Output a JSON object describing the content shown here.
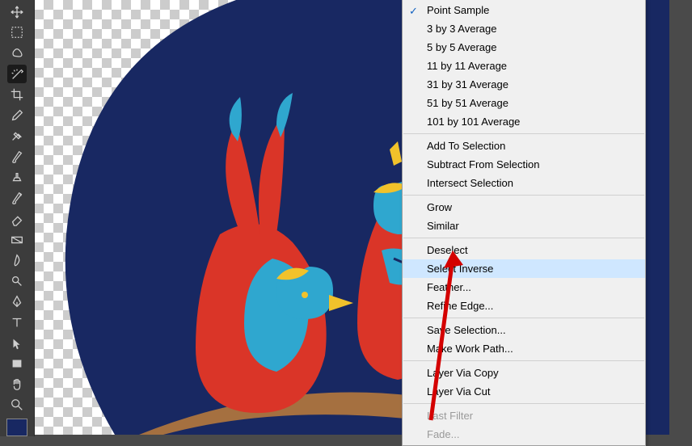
{
  "menu": {
    "items": [
      {
        "label": "Point Sample",
        "checked": true
      },
      {
        "label": "3 by 3 Average"
      },
      {
        "label": "5 by 5 Average"
      },
      {
        "label": "11 by 11 Average"
      },
      {
        "label": "31 by 31 Average"
      },
      {
        "label": "51 by 51 Average"
      },
      {
        "label": "101 by 101 Average"
      },
      {
        "sep": true
      },
      {
        "label": "Add To Selection"
      },
      {
        "label": "Subtract From Selection"
      },
      {
        "label": "Intersect Selection"
      },
      {
        "sep": true
      },
      {
        "label": "Grow"
      },
      {
        "label": "Similar"
      },
      {
        "sep": true
      },
      {
        "label": "Deselect"
      },
      {
        "label": "Select Inverse",
        "highlight": true
      },
      {
        "label": "Feather..."
      },
      {
        "label": "Refine Edge..."
      },
      {
        "sep": true
      },
      {
        "label": "Save Selection..."
      },
      {
        "label": "Make Work Path..."
      },
      {
        "sep": true
      },
      {
        "label": "Layer Via Copy"
      },
      {
        "label": "Layer Via Cut"
      },
      {
        "sep": true
      },
      {
        "label": "Last Filter",
        "disabled": true
      },
      {
        "label": "Fade...",
        "disabled": true
      }
    ]
  },
  "tools": [
    {
      "name": "move-tool"
    },
    {
      "name": "marquee-tool"
    },
    {
      "name": "lasso-tool"
    },
    {
      "name": "magic-wand-tool",
      "selected": true
    },
    {
      "name": "crop-tool"
    },
    {
      "name": "eyedropper-tool"
    },
    {
      "name": "healing-brush-tool"
    },
    {
      "name": "brush-tool"
    },
    {
      "name": "clone-stamp-tool"
    },
    {
      "name": "history-brush-tool"
    },
    {
      "name": "eraser-tool"
    },
    {
      "name": "gradient-tool"
    },
    {
      "name": "blur-tool"
    },
    {
      "name": "dodge-tool"
    },
    {
      "name": "pen-tool"
    },
    {
      "name": "type-tool"
    },
    {
      "name": "path-selection-tool"
    },
    {
      "name": "rectangle-tool"
    },
    {
      "name": "hand-tool"
    },
    {
      "name": "zoom-tool"
    }
  ],
  "colors": {
    "foreground": "#182862",
    "accent_red": "#da3528",
    "accent_cyan": "#2fa7cf",
    "accent_yellow": "#f1c22b"
  }
}
